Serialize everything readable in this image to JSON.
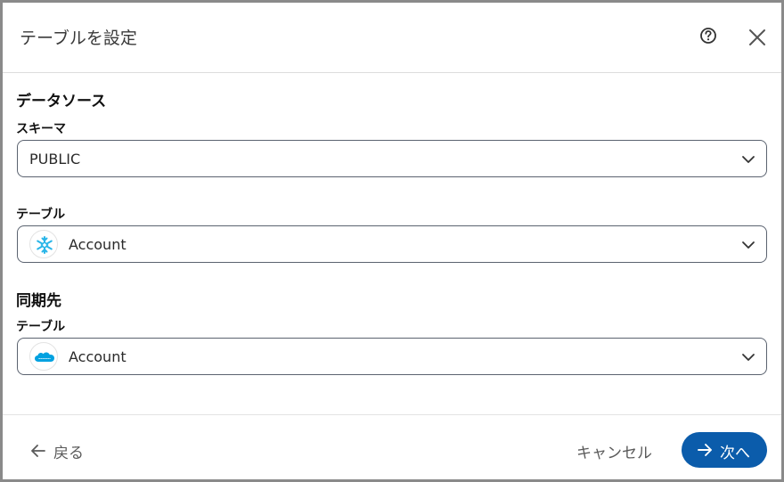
{
  "dialog": {
    "title": "テーブルを設定",
    "help_icon": "question-circle-icon",
    "close_icon": "close-icon"
  },
  "source": {
    "section_title": "データソース",
    "schema": {
      "label": "スキーマ",
      "value": "PUBLIC"
    },
    "table": {
      "label": "テーブル",
      "value": "Account",
      "logo": "snowflake-icon"
    }
  },
  "destination": {
    "section_title": "同期先",
    "table": {
      "label": "テーブル",
      "value": "Account",
      "logo": "salesforce-icon"
    }
  },
  "footer": {
    "back_label": "戻る",
    "cancel_label": "キャンセル",
    "next_label": "次へ"
  },
  "colors": {
    "primary": "#0b5cab",
    "snowflake": "#29b5e8",
    "salesforce": "#00a1e0"
  }
}
